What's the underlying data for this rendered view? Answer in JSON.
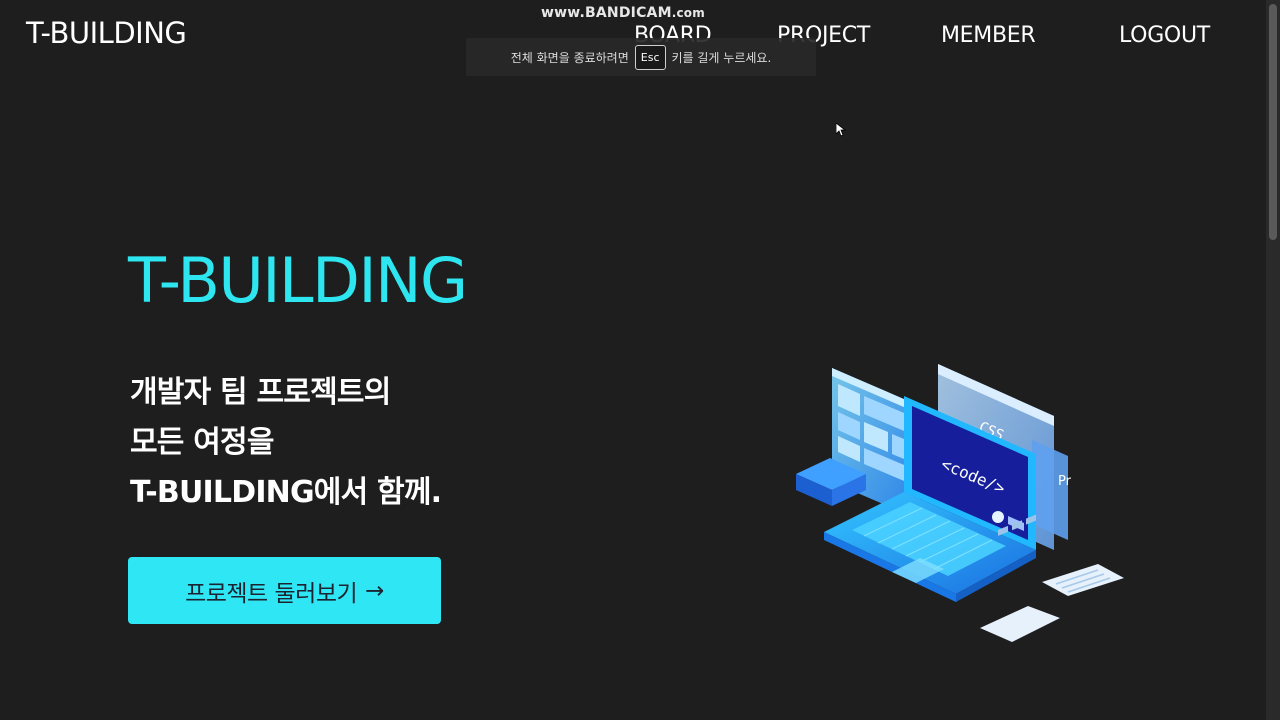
{
  "watermark": {
    "main": "www.BANDICAM",
    "suffix": ".com"
  },
  "fullscreen_notice": {
    "before": "전체 화면을 종료하려면",
    "key": "Esc",
    "after": "키를 길게 누르세요."
  },
  "header": {
    "logo": "T-BUILDING",
    "nav": {
      "board": "BOARD",
      "project": "PROJECT",
      "member": "MEMBER",
      "logout": "LOGOUT"
    }
  },
  "hero": {
    "title": "T-BUILDING",
    "lines": [
      "개발자 팀 프로젝트의",
      "모든 여정을",
      "T-BUILDING에서 함께."
    ],
    "cta_label": "프로젝트 둘러보기",
    "cta_arrow": "→"
  },
  "illustration": {
    "code_label": "<code/>",
    "css_label": "CSS",
    "side_label": "Pr"
  },
  "colors": {
    "background": "#1e1e1e",
    "accent": "#2ee6f0",
    "button_text": "#1b2430"
  },
  "icons": {
    "cta_arrow": "arrow-right-icon",
    "laptop": "laptop-illustration",
    "cursor": "mouse-pointer-icon"
  }
}
